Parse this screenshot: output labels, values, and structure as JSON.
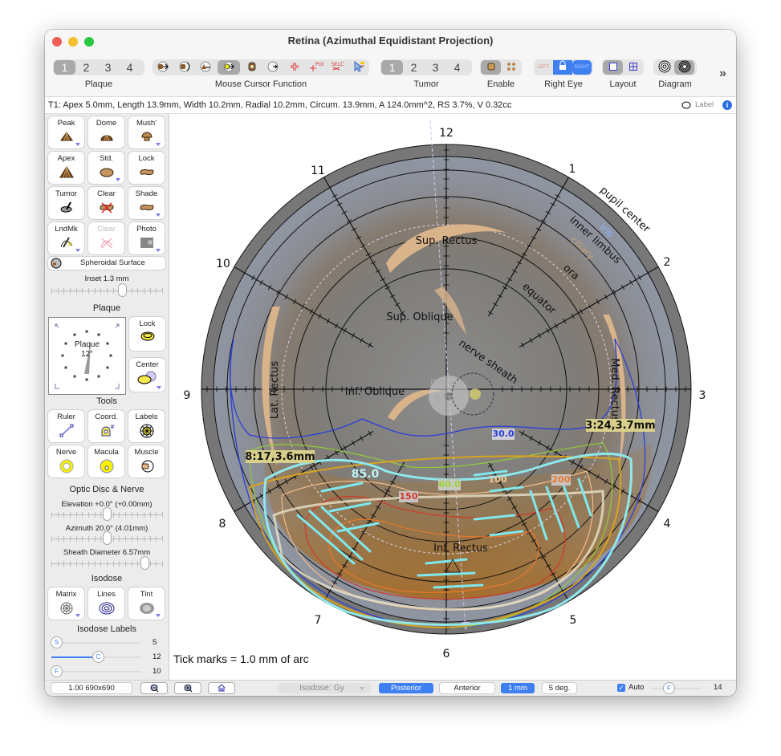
{
  "window": {
    "title": "Retina (Azimuthal Equidistant Projection)"
  },
  "toolbar": {
    "plaque_group": {
      "label": "Plaque",
      "options": [
        "1",
        "2",
        "3",
        "4"
      ],
      "selected": "1"
    },
    "cursor_group": {
      "label": "Mouse Cursor Function",
      "tools": [
        "plaque-move-icon",
        "plaque-rotate-icon",
        "apex-move-icon",
        "point-move-icon",
        "sutures-icon",
        "rotate-center-icon",
        "crosshair-icon",
        "poi-icon",
        "select-icon",
        "pointer-label-icon"
      ],
      "selected_index": 3
    },
    "tumor_group": {
      "label": "Tumor",
      "options": [
        "1",
        "2",
        "3",
        "4"
      ],
      "selected": "1"
    },
    "enable_group": {
      "label": "Enable",
      "options": [
        "single-tumor-icon",
        "multi-tumor-icon"
      ],
      "selected_index": 0
    },
    "eye_group": {
      "label": "Right Eye",
      "left_label": "LEFT",
      "right_label": "RIGHT",
      "selected": "RIGHT"
    },
    "layout_group": {
      "label": "Layout",
      "selected_index": 0
    },
    "diagram_group": {
      "label": "Diagram",
      "selected_index": 1
    },
    "more_label": "»"
  },
  "status": {
    "text": "T1: Apex 5.0mm, Length 13.9mm, Width 10.2mm, Radial 10.2mm, Circum. 13.9mm, A 124.0mm^2, RS 3.7%, V 0.32cc",
    "label_toggle": "Label"
  },
  "sidebar": {
    "tumor_buttons": [
      {
        "label": "Peak",
        "icon": "peak-tumor-icon",
        "dropdown": true
      },
      {
        "label": "Dome",
        "icon": "dome-tumor-icon",
        "dropdown": false
      },
      {
        "label": "Mush'",
        "icon": "mushroom-tumor-icon",
        "dropdown": true
      },
      {
        "label": "Apex",
        "icon": "apex-icon",
        "dropdown": false
      },
      {
        "label": "Std.",
        "icon": "standard-base-icon",
        "dropdown": true
      },
      {
        "label": "Lock",
        "icon": "lock-base-icon",
        "dropdown": false
      },
      {
        "label": "Tumor",
        "icon": "tumor-draw-icon",
        "dropdown": false
      },
      {
        "label": "Clear",
        "icon": "clear-tumor-icon",
        "dropdown": false
      },
      {
        "label": "Shade",
        "icon": "shade-icon",
        "dropdown": true
      },
      {
        "label": "LndMk",
        "icon": "landmark-icon",
        "dropdown": true
      },
      {
        "label": "Clear",
        "icon": "clear-landmark-icon",
        "dropdown": false,
        "disabled": true
      },
      {
        "label": "Photo",
        "icon": "photo-icon",
        "dropdown": true
      }
    ],
    "surface_button": "Spheroidal Surface",
    "inset_label": "Inset 1.3 mm",
    "inset_value_fraction": 0.65,
    "plaque_header": "Plaque",
    "plaque_dial": {
      "label": "Plaque",
      "value": "12°"
    },
    "plaque_lock": "Lock",
    "plaque_center": "Center",
    "tools_header": "Tools",
    "tools": [
      {
        "label": "Ruler",
        "icon": "ruler-icon"
      },
      {
        "label": "Coord.",
        "icon": "coordinate-icon"
      },
      {
        "label": "Labels",
        "icon": "labels-icon"
      },
      {
        "label": "Nerve",
        "icon": "nerve-icon"
      },
      {
        "label": "Macula",
        "icon": "macula-icon"
      },
      {
        "label": "Muscle",
        "icon": "muscle-icon"
      }
    ],
    "optic_header": "Optic Disc & Nerve",
    "elevation_label": "Elevation +0.0° (+0.00mm)",
    "elevation_fraction": 0.5,
    "azimuth_label": "Azimuth 20.0° (4.01mm)",
    "azimuth_fraction": 0.5,
    "sheath_label": "Sheath Diameter 6.57mm",
    "sheath_fraction": 0.87,
    "isodose_header": "Isodose",
    "isodose_buttons": [
      {
        "label": "Matrix",
        "icon": "matrix-icon"
      },
      {
        "label": "Lines",
        "icon": "lines-icon"
      },
      {
        "label": "Tint",
        "icon": "tint-icon"
      }
    ],
    "labels_header": "Isodose Labels",
    "label_sliders": [
      {
        "knob": "S",
        "value": "5",
        "fraction": 0.0
      },
      {
        "knob": "C",
        "value": "12",
        "fraction": 0.52
      },
      {
        "knob": "F",
        "value": "10",
        "fraction": 0.0
      }
    ]
  },
  "diagram": {
    "clock_labels": [
      "12",
      "1",
      "2",
      "3",
      "4",
      "5",
      "6",
      "7",
      "8",
      "9",
      "10",
      "11"
    ],
    "ring_labels": {
      "pupil": "pupil center",
      "iris": "iris",
      "limbus": "inner limbus",
      "ciliary": "ciliary",
      "ora": "ora",
      "equator": "equator"
    },
    "muscles": {
      "sup_rectus": "Sup. Rectus",
      "sup_oblique": "Sup. Oblique",
      "inf_oblique": "Inf. Oblique",
      "lat_rectus": "Lat. Rectus",
      "med_rectus": "Med. Rectus",
      "inf_rectus": "Inf. Rectus"
    },
    "macula_label": "macula",
    "fovea_label": "fovea",
    "nerve_label": "nerve sheath",
    "isodose_labels": [
      "30.0",
      "60.0",
      "85.0",
      "100",
      "150",
      "200"
    ],
    "margin_labels": [
      "8:17,3.6mm",
      "3:24,3.7mm"
    ],
    "footnote": "Tick marks = 1.0 mm of arc",
    "colors": {
      "iso30": "#2b3fd6",
      "iso60": "#8fc83a",
      "iso85": "#8ee8ec",
      "iso100": "#f0b98a",
      "iso150": "#d03a2a",
      "iso200": "#e9782b",
      "plaque_edge": "#d9a21f"
    }
  },
  "bottombar": {
    "zoom_readout": "1.00 690x690",
    "isodose_select": "Isodose: Gy",
    "posterior": "Posterior",
    "anterior": "Anterior",
    "grid_mm": "1 mm",
    "grid_deg": "5 deg.",
    "auto_label": "Auto",
    "auto_checked": true,
    "font_knob": "F",
    "font_value": "14"
  }
}
